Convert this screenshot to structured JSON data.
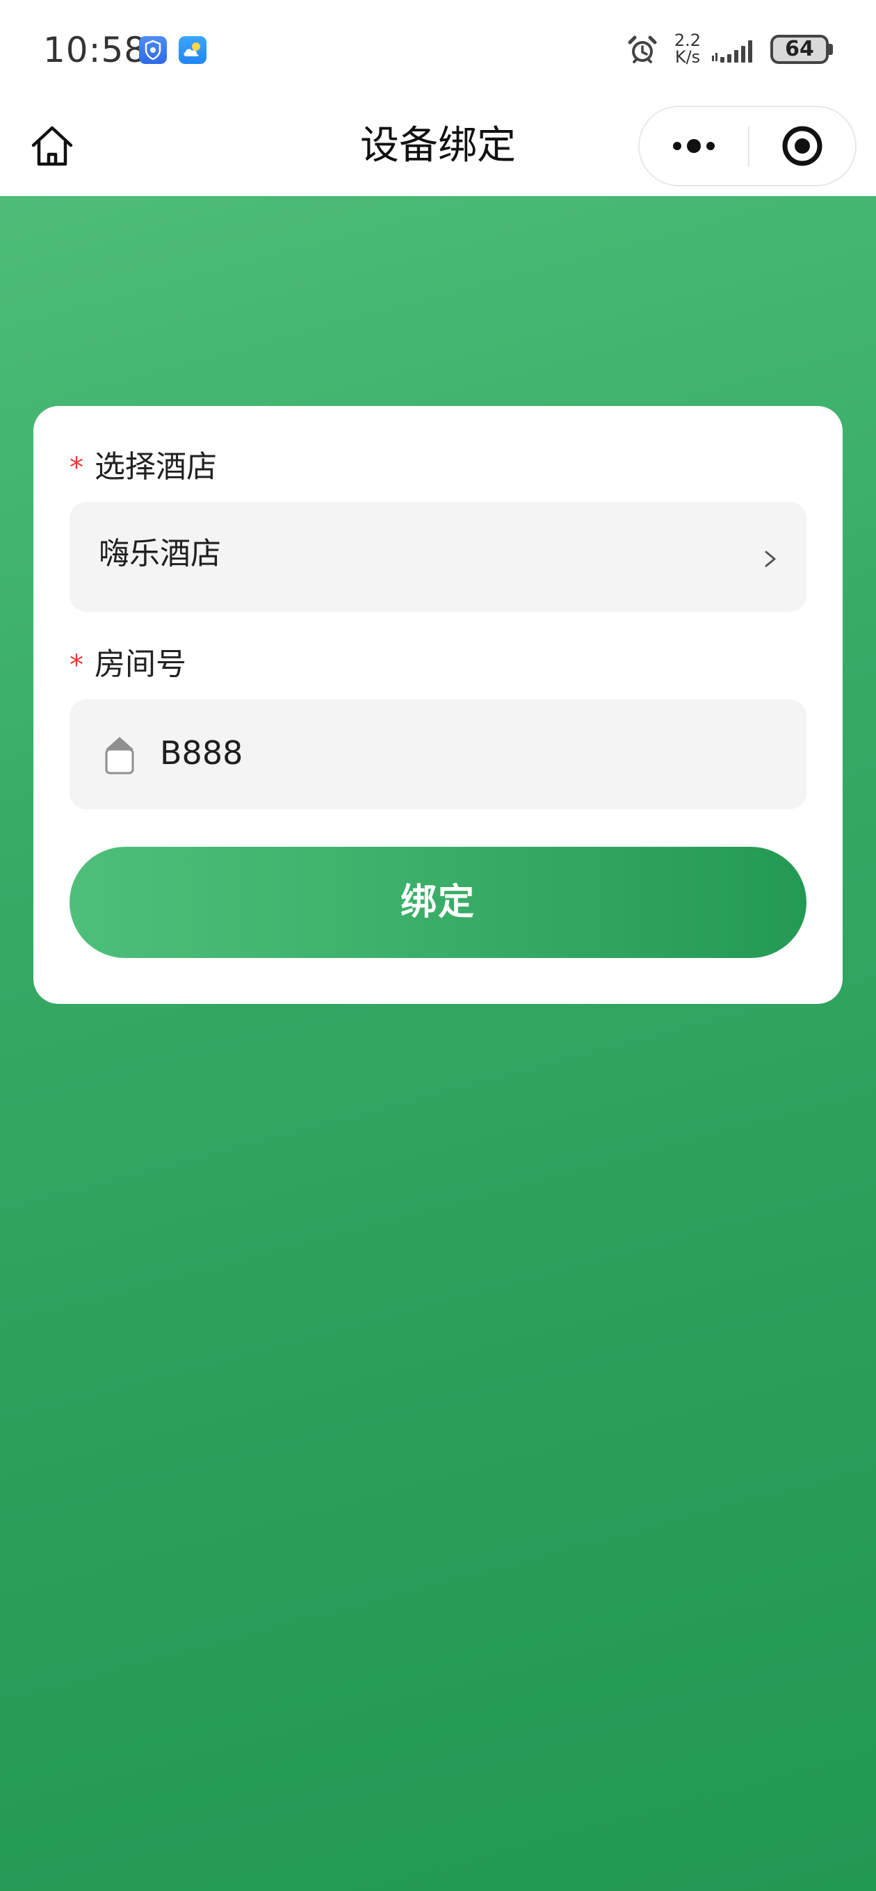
{
  "status_bar": {
    "time": "10:58",
    "net_speed_value": "2.2",
    "net_speed_unit": "K/s",
    "battery": "64",
    "icons": [
      "shield-app-icon",
      "weather-app-icon",
      "alarm-icon",
      "signal-icon",
      "battery-icon"
    ]
  },
  "nav": {
    "title": "设备绑定",
    "icons": [
      "home-icon",
      "more-icon",
      "close-mini-program-icon"
    ]
  },
  "form": {
    "hotel": {
      "label": "选择酒店",
      "required_mark": "*",
      "value": "嗨乐酒店",
      "chevron": "›"
    },
    "room": {
      "label": "房间号",
      "required_mark": "*",
      "value": "B888"
    },
    "submit_label": "绑定"
  },
  "colors": {
    "accent_green": "#2e9e5b",
    "gradient_start": "#4dbd78",
    "gradient_end": "#239853",
    "required_red": "#e53935",
    "input_bg": "#f4f4f4"
  }
}
